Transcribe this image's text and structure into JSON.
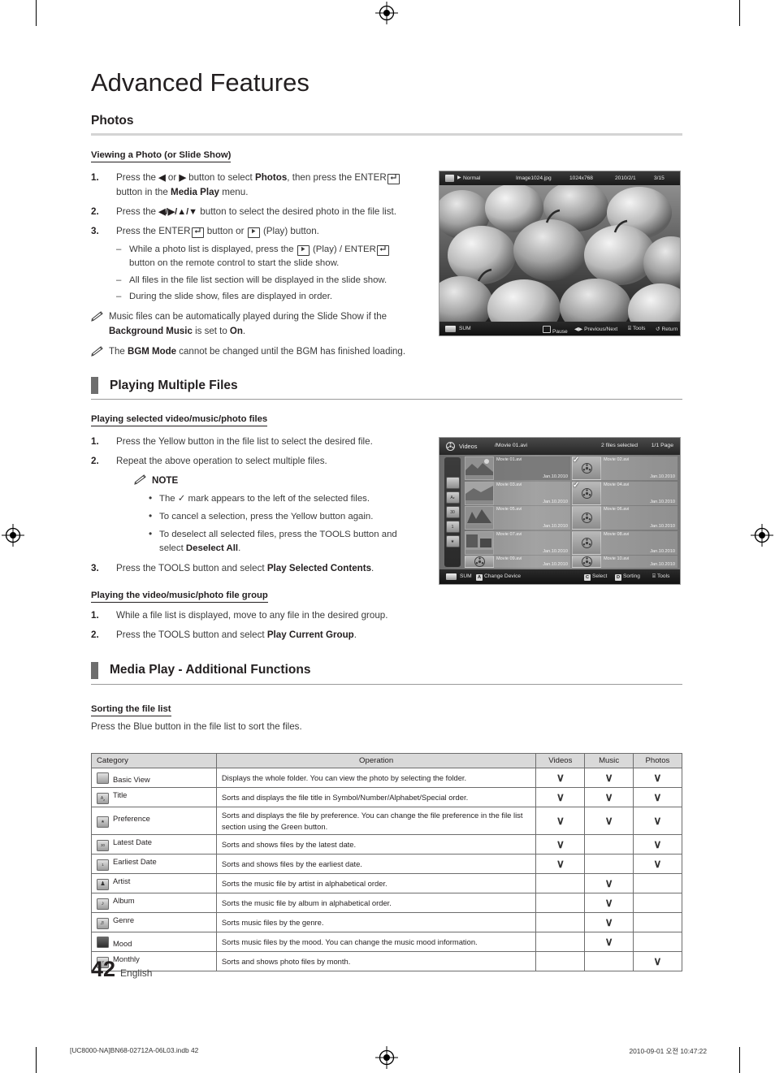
{
  "chapter_title": "Advanced Features",
  "photos_section": {
    "heading": "Photos",
    "sub_heading": "Viewing a Photo (or Slide Show)",
    "steps": [
      {
        "num": "1.",
        "parts": [
          {
            "t": "Press the "
          },
          {
            "b": "◀"
          },
          {
            "t": " or "
          },
          {
            "b": "▶"
          },
          {
            "t": " button to select "
          },
          {
            "bold": "Photos"
          },
          {
            "t": ", then press the ENTER"
          },
          {
            "key": "enter"
          },
          {
            "t": " button in the "
          },
          {
            "bold": "Media Play"
          },
          {
            "t": " menu."
          }
        ]
      },
      {
        "num": "2.",
        "parts": [
          {
            "t": "Press the "
          },
          {
            "b": "◀/▶/▲/▼"
          },
          {
            "t": " button to select the desired photo in the file list."
          }
        ]
      },
      {
        "num": "3.",
        "parts": [
          {
            "t": "Press the ENTER"
          },
          {
            "key": "enter"
          },
          {
            "t": " button or "
          },
          {
            "key": "play"
          },
          {
            "t": " (Play) button."
          }
        ]
      }
    ],
    "dashes": [
      "While a photo list is displayed, press the [play] (Play) / ENTER[enter] button on the remote control to start the slide show.",
      "All files in the file list section will be displayed in the slide show.",
      "During the slide show, files are displayed in order."
    ],
    "notes": [
      "Music files can be automatically played during the Slide Show if the Background Music is set to On.",
      "The BGM Mode cannot be changed until the BGM has finished loading."
    ]
  },
  "multiple_files_section": {
    "heading": "Playing Multiple Files",
    "sub_heading_selected": "Playing selected video/music/photo files",
    "steps_selected": [
      "Press the Yellow button in the file list to select the desired file.",
      "Repeat the above operation to select multiple files.",
      "Press the TOOLS button and select Play Selected Contents."
    ],
    "note_label": "NOTE",
    "note_bullets": [
      "The ✓ mark appears to the left of the selected files.",
      "To cancel a selection, press the Yellow button again.",
      "To deselect all selected files, press the TOOLS button and select Deselect All."
    ],
    "sub_heading_group": "Playing the video/music/photo file group",
    "steps_group": [
      "While a file list is displayed, move to any file in the desired group.",
      "Press the TOOLS button and select Play Current Group."
    ]
  },
  "additional_functions_section": {
    "heading": "Media Play - Additional Functions",
    "sub_heading": "Sorting the file list",
    "intro": "Press the Blue button in the file list to sort the files."
  },
  "photo_viewer_screenshot": {
    "mode_label": "Normal",
    "file_name": "Image1024.jpg",
    "resolution": "1024x768",
    "date": "2010/2/1",
    "counter": "3/15",
    "device": "SUM",
    "actions": [
      {
        "icon": "enter-key-icon",
        "label": "Pause"
      },
      {
        "icon": "left-right-icon",
        "label": "Previous/Next"
      },
      {
        "icon": "tools-icon",
        "label": "Tools"
      },
      {
        "icon": "return-icon",
        "label": "Return"
      }
    ]
  },
  "video_browser_screenshot": {
    "title": "Videos",
    "path": "/Movie 01.avi",
    "selected_text": "2 files selected",
    "page_text": "1/1 Page",
    "device": "SUM",
    "change_device_label": "Change Device",
    "change_device_key": "A",
    "sidebar_icons": [
      "folder-icon",
      "title-sort-icon",
      "latest-date-icon",
      "earliest-date-icon",
      "preference-star-icon"
    ],
    "files": [
      {
        "name": "Movie 01.avi",
        "date": "Jan.10.2010",
        "type": "thumb",
        "selected": true,
        "checked": false
      },
      {
        "name": "Movie 02.avi",
        "date": "Jan.10.2010",
        "type": "reel",
        "selected": false,
        "checked": true
      },
      {
        "name": "Movie 03.avi",
        "date": "Jan.10.2010",
        "type": "thumb",
        "selected": false,
        "checked": false
      },
      {
        "name": "Movie 04.avi",
        "date": "Jan.10.2010",
        "type": "reel",
        "selected": false,
        "checked": true
      },
      {
        "name": "Movie 05.avi",
        "date": "Jan.10.2010",
        "type": "thumb",
        "selected": false,
        "checked": false
      },
      {
        "name": "Movie 06.avi",
        "date": "Jan.10.2010",
        "type": "reel",
        "selected": false,
        "checked": false
      },
      {
        "name": "Movie 07.avi",
        "date": "Jan.10.2010",
        "type": "thumb",
        "selected": false,
        "checked": false
      },
      {
        "name": "Movie 08.avi",
        "date": "Jan.10.2010",
        "type": "reel",
        "selected": false,
        "checked": false
      },
      {
        "name": "Movie 09.avi",
        "date": "Jan.10.2010",
        "type": "reel",
        "selected": false,
        "checked": false
      },
      {
        "name": "Movie 10.avi",
        "date": "Jan.10.2010",
        "type": "reel",
        "selected": false,
        "checked": false
      }
    ],
    "actions": [
      {
        "key": "C",
        "label": "Select"
      },
      {
        "key": "D",
        "label": "Sorting"
      },
      {
        "key": "tools-icon",
        "label": "Tools"
      }
    ]
  },
  "sort_table": {
    "headers": [
      "Category",
      "Operation",
      "Videos",
      "Music",
      "Photos"
    ],
    "rows": [
      {
        "icon": "folder-icon",
        "category": "Basic View",
        "operation": "Displays the whole folder. You can view the photo by selecting the folder.",
        "videos": "∨",
        "music": "∨",
        "photos": "∨"
      },
      {
        "icon": "title-sort-icon",
        "category": "Title",
        "operation": "Sorts and displays the file title in Symbol/Number/Alphabet/Special order.",
        "videos": "∨",
        "music": "∨",
        "photos": "∨"
      },
      {
        "icon": "preference-star-icon",
        "category": "Preference",
        "operation": "Sorts and displays the file by preference. You can change the file preference in the file list section using the Green button.",
        "videos": "∨",
        "music": "∨",
        "photos": "∨"
      },
      {
        "icon": "latest-date-icon",
        "category": "Latest Date",
        "operation": "Sorts and shows files by the latest date.",
        "videos": "∨",
        "music": "",
        "photos": "∨"
      },
      {
        "icon": "earliest-date-icon",
        "category": "Earliest Date",
        "operation": "Sorts and shows files by the earliest date.",
        "videos": "∨",
        "music": "",
        "photos": "∨"
      },
      {
        "icon": "artist-icon",
        "category": "Artist",
        "operation": "Sorts the music file by artist in alphabetical order.",
        "videos": "",
        "music": "∨",
        "photos": ""
      },
      {
        "icon": "album-icon",
        "category": "Album",
        "operation": "Sorts the music file by album in alphabetical order.",
        "videos": "",
        "music": "∨",
        "photos": ""
      },
      {
        "icon": "genre-icon",
        "category": "Genre",
        "operation": "Sorts music files by the genre.",
        "videos": "",
        "music": "∨",
        "photos": ""
      },
      {
        "icon": "mood-icon",
        "category": "Mood",
        "operation": "Sorts music files by the mood. You can change the music mood information.",
        "videos": "",
        "music": "∨",
        "photos": ""
      },
      {
        "icon": "monthly-icon",
        "category": "Monthly",
        "operation": "Sorts and shows photo files by month.",
        "videos": "",
        "music": "",
        "photos": "∨"
      }
    ]
  },
  "page_footer": {
    "page_number": "42",
    "language": "English"
  },
  "doc_footer": {
    "left": "[UC8000-NA]BN68-02712A-06L03.indb   42",
    "right": "2010-09-01   오전 10:47:22"
  }
}
